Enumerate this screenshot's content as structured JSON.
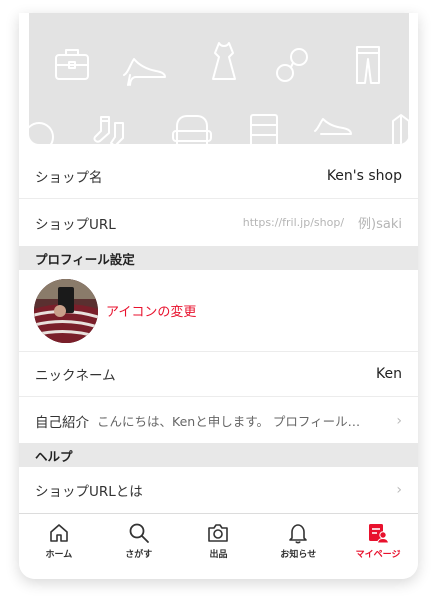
{
  "profile": {
    "shop_name_label": "ショップ名",
    "shop_name_value": "Ken's shop",
    "shop_url_label": "ショップURL",
    "shop_url_placeholder": "https://fril.jp/shop/",
    "shop_url_example": "例)saki"
  },
  "sections": {
    "profile_settings": "プロフィール設定",
    "help": "ヘルプ"
  },
  "avatar": {
    "change_label": "アイコンの変更"
  },
  "nickname": {
    "label": "ニックネーム",
    "value": "Ken"
  },
  "bio": {
    "label": "自己紹介",
    "value": "こんにちは、Kenと申します。 プロフィール…"
  },
  "help": {
    "shop_url_about": "ショップURLとは"
  },
  "tabs": [
    {
      "label": "ホーム",
      "icon": "home-icon",
      "active": false
    },
    {
      "label": "さがす",
      "icon": "search-icon",
      "active": false
    },
    {
      "label": "出品",
      "icon": "camera-icon",
      "active": false
    },
    {
      "label": "お知らせ",
      "icon": "bell-icon",
      "active": false
    },
    {
      "label": "マイページ",
      "icon": "mypage-icon",
      "active": true
    }
  ],
  "colors": {
    "accent": "#e8112d",
    "section_bg": "#e8e8e8",
    "cover_bg": "#e3e3e3"
  }
}
